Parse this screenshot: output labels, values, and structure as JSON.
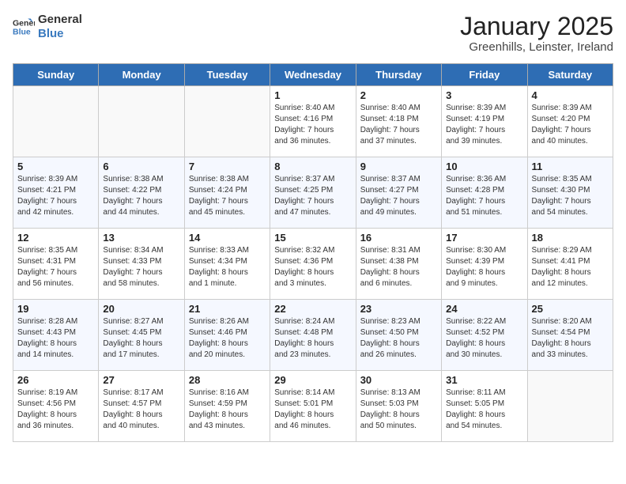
{
  "logo": {
    "line1": "General",
    "line2": "Blue"
  },
  "title": "January 2025",
  "subtitle": "Greenhills, Leinster, Ireland",
  "weekdays": [
    "Sunday",
    "Monday",
    "Tuesday",
    "Wednesday",
    "Thursday",
    "Friday",
    "Saturday"
  ],
  "weeks": [
    [
      {
        "day": "",
        "info": ""
      },
      {
        "day": "",
        "info": ""
      },
      {
        "day": "",
        "info": ""
      },
      {
        "day": "1",
        "info": "Sunrise: 8:40 AM\nSunset: 4:16 PM\nDaylight: 7 hours\nand 36 minutes."
      },
      {
        "day": "2",
        "info": "Sunrise: 8:40 AM\nSunset: 4:18 PM\nDaylight: 7 hours\nand 37 minutes."
      },
      {
        "day": "3",
        "info": "Sunrise: 8:39 AM\nSunset: 4:19 PM\nDaylight: 7 hours\nand 39 minutes."
      },
      {
        "day": "4",
        "info": "Sunrise: 8:39 AM\nSunset: 4:20 PM\nDaylight: 7 hours\nand 40 minutes."
      }
    ],
    [
      {
        "day": "5",
        "info": "Sunrise: 8:39 AM\nSunset: 4:21 PM\nDaylight: 7 hours\nand 42 minutes."
      },
      {
        "day": "6",
        "info": "Sunrise: 8:38 AM\nSunset: 4:22 PM\nDaylight: 7 hours\nand 44 minutes."
      },
      {
        "day": "7",
        "info": "Sunrise: 8:38 AM\nSunset: 4:24 PM\nDaylight: 7 hours\nand 45 minutes."
      },
      {
        "day": "8",
        "info": "Sunrise: 8:37 AM\nSunset: 4:25 PM\nDaylight: 7 hours\nand 47 minutes."
      },
      {
        "day": "9",
        "info": "Sunrise: 8:37 AM\nSunset: 4:27 PM\nDaylight: 7 hours\nand 49 minutes."
      },
      {
        "day": "10",
        "info": "Sunrise: 8:36 AM\nSunset: 4:28 PM\nDaylight: 7 hours\nand 51 minutes."
      },
      {
        "day": "11",
        "info": "Sunrise: 8:35 AM\nSunset: 4:30 PM\nDaylight: 7 hours\nand 54 minutes."
      }
    ],
    [
      {
        "day": "12",
        "info": "Sunrise: 8:35 AM\nSunset: 4:31 PM\nDaylight: 7 hours\nand 56 minutes."
      },
      {
        "day": "13",
        "info": "Sunrise: 8:34 AM\nSunset: 4:33 PM\nDaylight: 7 hours\nand 58 minutes."
      },
      {
        "day": "14",
        "info": "Sunrise: 8:33 AM\nSunset: 4:34 PM\nDaylight: 8 hours\nand 1 minute."
      },
      {
        "day": "15",
        "info": "Sunrise: 8:32 AM\nSunset: 4:36 PM\nDaylight: 8 hours\nand 3 minutes."
      },
      {
        "day": "16",
        "info": "Sunrise: 8:31 AM\nSunset: 4:38 PM\nDaylight: 8 hours\nand 6 minutes."
      },
      {
        "day": "17",
        "info": "Sunrise: 8:30 AM\nSunset: 4:39 PM\nDaylight: 8 hours\nand 9 minutes."
      },
      {
        "day": "18",
        "info": "Sunrise: 8:29 AM\nSunset: 4:41 PM\nDaylight: 8 hours\nand 12 minutes."
      }
    ],
    [
      {
        "day": "19",
        "info": "Sunrise: 8:28 AM\nSunset: 4:43 PM\nDaylight: 8 hours\nand 14 minutes."
      },
      {
        "day": "20",
        "info": "Sunrise: 8:27 AM\nSunset: 4:45 PM\nDaylight: 8 hours\nand 17 minutes."
      },
      {
        "day": "21",
        "info": "Sunrise: 8:26 AM\nSunset: 4:46 PM\nDaylight: 8 hours\nand 20 minutes."
      },
      {
        "day": "22",
        "info": "Sunrise: 8:24 AM\nSunset: 4:48 PM\nDaylight: 8 hours\nand 23 minutes."
      },
      {
        "day": "23",
        "info": "Sunrise: 8:23 AM\nSunset: 4:50 PM\nDaylight: 8 hours\nand 26 minutes."
      },
      {
        "day": "24",
        "info": "Sunrise: 8:22 AM\nSunset: 4:52 PM\nDaylight: 8 hours\nand 30 minutes."
      },
      {
        "day": "25",
        "info": "Sunrise: 8:20 AM\nSunset: 4:54 PM\nDaylight: 8 hours\nand 33 minutes."
      }
    ],
    [
      {
        "day": "26",
        "info": "Sunrise: 8:19 AM\nSunset: 4:56 PM\nDaylight: 8 hours\nand 36 minutes."
      },
      {
        "day": "27",
        "info": "Sunrise: 8:17 AM\nSunset: 4:57 PM\nDaylight: 8 hours\nand 40 minutes."
      },
      {
        "day": "28",
        "info": "Sunrise: 8:16 AM\nSunset: 4:59 PM\nDaylight: 8 hours\nand 43 minutes."
      },
      {
        "day": "29",
        "info": "Sunrise: 8:14 AM\nSunset: 5:01 PM\nDaylight: 8 hours\nand 46 minutes."
      },
      {
        "day": "30",
        "info": "Sunrise: 8:13 AM\nSunset: 5:03 PM\nDaylight: 8 hours\nand 50 minutes."
      },
      {
        "day": "31",
        "info": "Sunrise: 8:11 AM\nSunset: 5:05 PM\nDaylight: 8 hours\nand 54 minutes."
      },
      {
        "day": "",
        "info": ""
      }
    ]
  ]
}
